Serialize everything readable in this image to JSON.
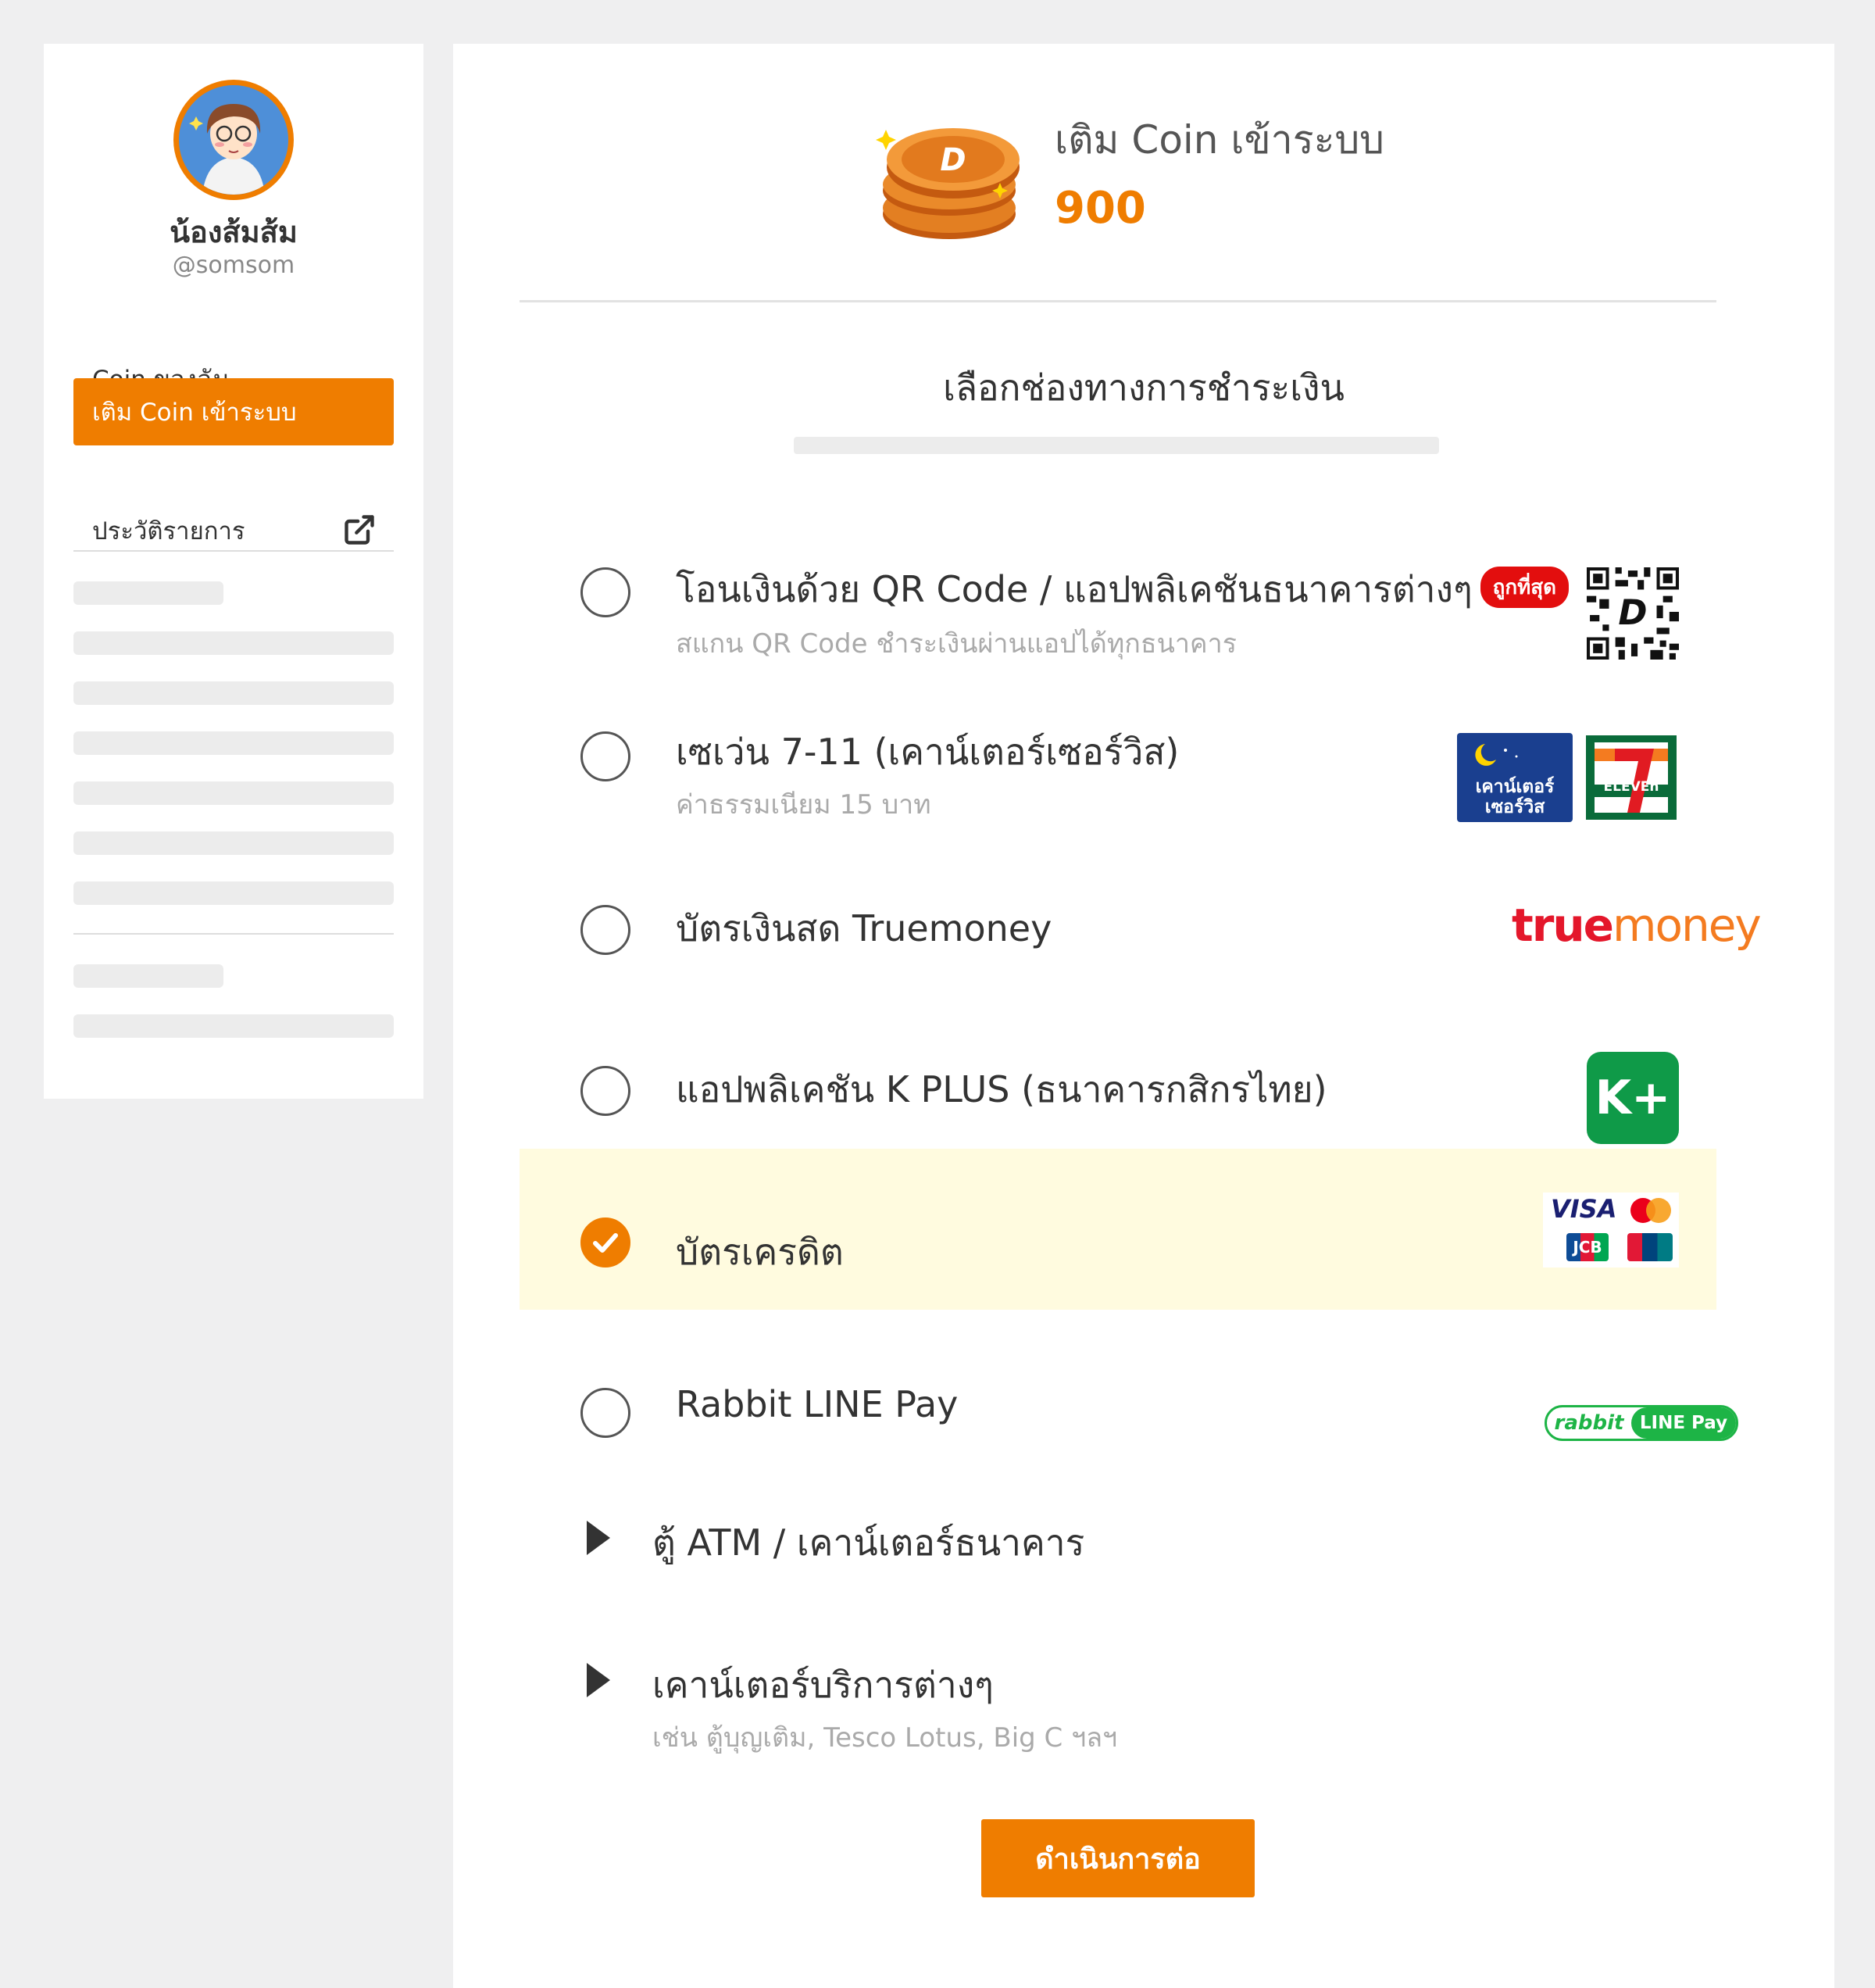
{
  "sidebar": {
    "profile": {
      "name": "น้องส้มส้ม",
      "handle": "@somsom"
    },
    "nav": [
      {
        "label": "Coin ของฉัน"
      },
      {
        "label": "เติม Coin เข้าระบบ",
        "active": true
      },
      {
        "label": "ประวัติรายการ",
        "icon": "external-link-icon"
      }
    ]
  },
  "topup": {
    "title": "เติม Coin เข้าระบบ",
    "amount": "900"
  },
  "payment": {
    "title": "เลือกช่องทางการชำระเงิน",
    "options": [
      {
        "label": "โอนเงินด้วย QR Code / แอปพลิเคชันธนาคารต่างๆ",
        "badge": "ถูกที่สุด",
        "sub": "สแกน QR Code ชำระเงินผ่านแอปได้ทุกธนาคาร",
        "logo": "qr-code-icon",
        "selected": false
      },
      {
        "label": "เซเว่น 7-11 (เคาน์เตอร์เซอร์วิส)",
        "sub": "ค่าธรรมเนียม 15 บาท",
        "logo": "counter-service-7eleven-logo",
        "logo_text_1": "เคาน์เตอร์\nเซอร์วิส",
        "logo_text_2": "ELEVEn",
        "selected": false
      },
      {
        "label": "บัตรเงินสด Truemoney",
        "logo": "truemoney-logo",
        "logo_text_1": "true",
        "logo_text_2": "money",
        "selected": false
      },
      {
        "label": "แอปพลิเคชัน K PLUS (ธนาคารกสิกรไทย)",
        "logo": "kplus-logo",
        "logo_text_1": "K+",
        "selected": false
      },
      {
        "label": "บัตรเครดิต",
        "logo": "credit-card-logos",
        "logo_text_1": "VISA",
        "logo_text_2": "JCB",
        "logo_text_3": "MasterCard",
        "logo_text_4": "UnionPay",
        "selected": true
      },
      {
        "label": "Rabbit LINE Pay",
        "logo": "rabbit-line-pay-logo",
        "logo_text_1": "rabbit",
        "logo_text_2": "LINE Pay",
        "selected": false
      }
    ],
    "expanders": [
      {
        "label": "ตู้ ATM / เคาน์เตอร์ธนาคาร"
      },
      {
        "label": "เคาน์เตอร์บริการต่างๆ",
        "sub": "เช่น ตู้บุญเติม, Tesco Lotus, Big C ฯลฯ"
      }
    ]
  },
  "actions": {
    "continue_label": "ดำเนินการต่อ"
  },
  "colors": {
    "accent": "#ef7d00",
    "selected_bg": "#fffbdf",
    "badge": "#e30e0e"
  }
}
